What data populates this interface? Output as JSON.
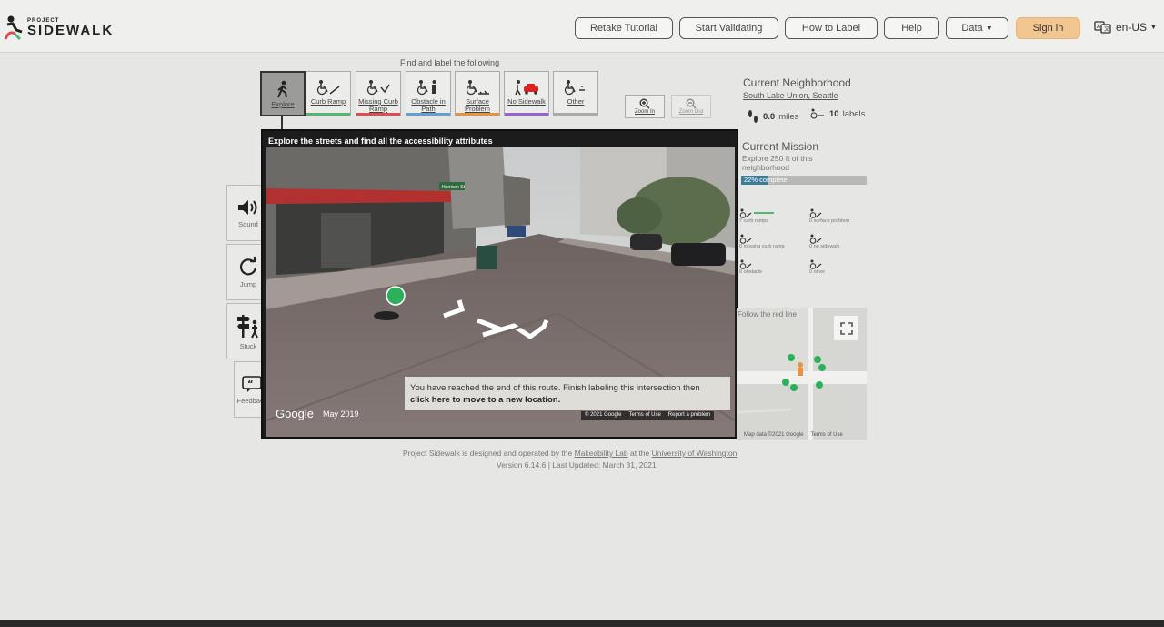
{
  "brand": {
    "small": "PROJECT",
    "big": "SIDEWALK"
  },
  "nav": {
    "retake_tutorial": "Retake Tutorial",
    "start_validating": "Start Validating",
    "how_to_label": "How to Label",
    "help": "Help",
    "data": "Data",
    "sign_in": "Sign in",
    "language": "en-US"
  },
  "toolbar": {
    "heading": "Find and label the following",
    "tools": [
      {
        "id": "explore",
        "label": "Explore",
        "icon": "walking-person-icon"
      },
      {
        "id": "curb-ramp",
        "label": "Curb Ramp",
        "icon": "curb-ramp-icon",
        "color": "#50b86f"
      },
      {
        "id": "missing-curb-ramp",
        "label": "Missing Curb Ramp",
        "icon": "missing-curb-ramp-icon",
        "color": "#e04b4b"
      },
      {
        "id": "obstacle",
        "label": "Obstacle in Path",
        "icon": "obstacle-icon",
        "color": "#5fa0d6"
      },
      {
        "id": "surface-problem",
        "label": "Surface Problem",
        "icon": "surface-problem-icon",
        "color": "#e5933f"
      },
      {
        "id": "no-sidewalk",
        "label": "No Sidewalk",
        "icon": "no-sidewalk-icon",
        "color": "#9a62d1"
      },
      {
        "id": "other",
        "label": "Other",
        "icon": "other-icon",
        "color": "#aaaaaa"
      }
    ],
    "zoom_in": "Zoom In",
    "zoom_out": "Zoom Out"
  },
  "side_controls": {
    "sound": "Sound",
    "jump": "Jump",
    "stuck": "Stuck",
    "feedback": "Feedback"
  },
  "panorama": {
    "title": "Explore the streets and find all the accessibility attributes",
    "street_sign": "Harrison St",
    "message_text": "You have reached the end of this route. Finish labeling this intersection then",
    "message_link": "click here to move to a new location.",
    "google": "Google",
    "date": "May 2019",
    "credits": [
      "© 2021 Google",
      "Terms of Use",
      "Report a problem"
    ]
  },
  "neighborhood": {
    "heading": "Current Neighborhood",
    "name": "South Lake Union, Seattle",
    "distance_value": "0.0",
    "distance_unit": "miles",
    "labels_value": "10",
    "labels_unit": "labels"
  },
  "mission": {
    "heading": "Current Mission",
    "description": "Explore 250 ft of this neighborhood",
    "progress_text": "22% complete",
    "progress_value": 0.22
  },
  "label_counts": [
    {
      "text": "7 curb ramps",
      "icon": "curb-ramp-icon",
      "color": "#50b86f"
    },
    {
      "text": "0 surface problem",
      "icon": "surface-problem-icon",
      "color": "#e5933f"
    },
    {
      "text": "0 missing curb ramp",
      "icon": "missing-curb-ramp-icon",
      "color": "#e04b4b"
    },
    {
      "text": "0 no sidewalk",
      "icon": "no-sidewalk-icon",
      "color": "#9a62d1"
    },
    {
      "text": "0 obstacle",
      "icon": "obstacle-icon",
      "color": "#5fa0d6"
    },
    {
      "text": "0 other",
      "icon": "other-icon",
      "color": "#aaaaaa"
    }
  ],
  "minimap": {
    "instruction": "Follow the red line",
    "credits": [
      "Map data ©2021 Google",
      "Terms of Use"
    ]
  },
  "footer": {
    "prefix": "Project Sidewalk is designed and operated by the",
    "lab": "Makeability Lab",
    "middle": "at the",
    "university": "University of Washington",
    "version": "Version 6.14.6 | Last Updated: March 31, 2021"
  },
  "colors": {
    "accent_signin": "#f2c690",
    "progress": "#3e7d98",
    "curb_ramp": "#50b86f",
    "missing_curb_ramp": "#e04b4b",
    "obstacle": "#5fa0d6",
    "surface_problem": "#e5933f",
    "no_sidewalk": "#9a62d1"
  }
}
